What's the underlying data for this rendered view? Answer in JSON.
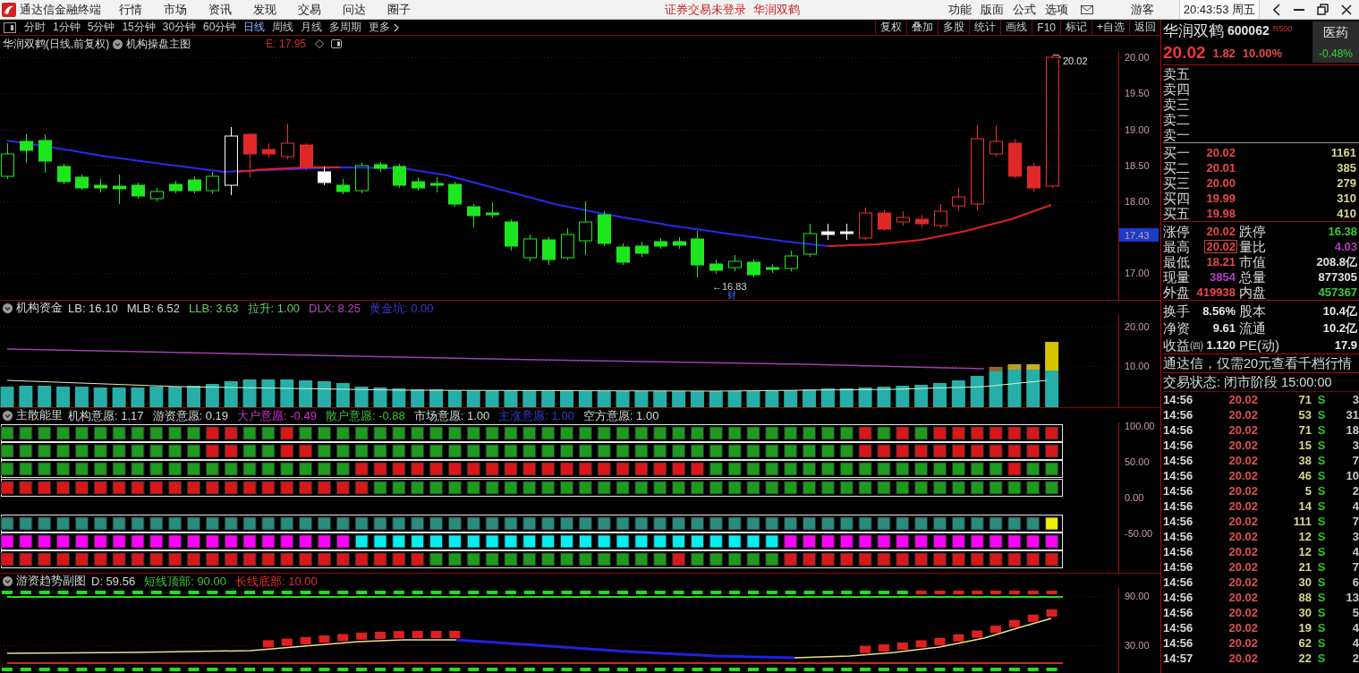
{
  "title_bar": {
    "app_name": "通达信金融终端",
    "menu": [
      "行情",
      "市场",
      "资讯",
      "发现",
      "交易",
      "问达",
      "圈子"
    ],
    "notice": "证券交易未登录",
    "stock_link": "华润双鹤",
    "tools": [
      "功能",
      "版面",
      "公式",
      "选项"
    ],
    "user": "游客",
    "clock": "20:43:53 周五"
  },
  "period_bar": {
    "periods": [
      {
        "label": "分时",
        "selected": false
      },
      {
        "label": "1分钟",
        "selected": false
      },
      {
        "label": "5分钟",
        "selected": false
      },
      {
        "label": "15分钟",
        "selected": false
      },
      {
        "label": "30分钟",
        "selected": false
      },
      {
        "label": "60分钟",
        "selected": false
      },
      {
        "label": "日线",
        "selected": true
      },
      {
        "label": "周线",
        "selected": false
      },
      {
        "label": "月线",
        "selected": false
      },
      {
        "label": "多周期",
        "selected": false
      }
    ],
    "more": "更多",
    "tools": [
      "复权",
      "叠加",
      "多股",
      "统计",
      "画线",
      "F10",
      "标记",
      "+自选",
      "返回"
    ]
  },
  "main_chart": {
    "title": "华润双鹤(日线,前复权)",
    "indicator": "机构操盘主图",
    "readouts": [
      {
        "text": "E: 17.95",
        "color": "#c83232"
      }
    ],
    "price_axis": [
      "20.00",
      "19.50",
      "19.00",
      "18.50",
      "18.00",
      "17.00"
    ],
    "last_price": "17.43",
    "high_label": "20.02",
    "low_label": "←16.83",
    "event_mark": "财"
  },
  "indicator_panels": [
    {
      "kind": "fund_bars",
      "title": "机构资金",
      "readouts": [
        {
          "text": "LB: 16.10",
          "color": "#d8d8d8"
        },
        {
          "text": "MLB: 6.52",
          "color": "#d8d8d8"
        },
        {
          "text": "LLB: 3.63",
          "color": "#6cc86c"
        },
        {
          "text": "拉升: 1.00",
          "color": "#6cc86c"
        },
        {
          "text": "DLX: 8.25",
          "color": "#b048c0"
        },
        {
          "text": "黄金坑: 0.00",
          "color": "#3a3ad0"
        }
      ],
      "axis": [
        "20.00",
        "10.00"
      ]
    },
    {
      "kind": "signal_grid",
      "title": "主散能里",
      "readouts": [
        {
          "text": "机构意愿: 1.17",
          "color": "#d8d8d8"
        },
        {
          "text": "游资意愿: 0.19",
          "color": "#d8d8d8"
        },
        {
          "text": "大户意愿: -0.49",
          "color": "#d030d0"
        },
        {
          "text": "散户意愿: -0.88",
          "color": "#40c040"
        },
        {
          "text": "市场意愿: 1.00",
          "color": "#d8d8d8"
        },
        {
          "text": "主涨意愿: 1.00",
          "color": "#3a3ad0"
        },
        {
          "text": "空方意愿: 1.00",
          "color": "#d8d8d8"
        }
      ],
      "axis": [
        "100.00",
        "50.00",
        "0.00",
        "-50.00"
      ]
    },
    {
      "kind": "trend",
      "title": "游资趋势副图",
      "readouts": [
        {
          "text": "D: 59.56",
          "color": "#d8d8d8"
        },
        {
          "text": "短线顶部: 90.00",
          "color": "#40c040"
        },
        {
          "text": "长线底部: 10.00",
          "color": "#e03030"
        }
      ],
      "axis": [
        "90.00",
        "30.00"
      ]
    }
  ],
  "quote_panel": {
    "name": "华润双鹤",
    "code": "600062",
    "badge": "R500",
    "sector": {
      "name": "医药",
      "change": "-0.48%"
    },
    "price": "20.02",
    "change": "1.82",
    "change_pct": "10.00%",
    "asks": [
      "卖五",
      "卖四",
      "卖三",
      "卖二",
      "卖一"
    ],
    "bids": [
      {
        "label": "买一",
        "price": "20.02",
        "volume": "1161"
      },
      {
        "label": "买二",
        "price": "20.01",
        "volume": "385"
      },
      {
        "label": "买三",
        "price": "20.00",
        "volume": "279"
      },
      {
        "label": "买四",
        "price": "19.99",
        "volume": "310"
      },
      {
        "label": "买五",
        "price": "19.98",
        "volume": "410"
      }
    ],
    "stats": [
      {
        "label": "涨停",
        "value": "20.02",
        "color": "#e84848",
        "outlined": false
      },
      {
        "label": "跌停",
        "value": "16.38",
        "color": "#3cc83c",
        "outlined": false
      },
      {
        "label": "最高",
        "value": "20.02",
        "color": "#e84848",
        "outlined": true
      },
      {
        "label": "量比",
        "value": "4.03",
        "color": "#b040c0",
        "outlined": false
      },
      {
        "label": "最低",
        "value": "18.21",
        "color": "#e84848",
        "outlined": false
      },
      {
        "label": "市值",
        "value": "208.8亿",
        "color": "#e0e0e0",
        "outlined": false
      },
      {
        "label": "现量",
        "value": "3854",
        "color": "#b040c0",
        "outlined": false
      },
      {
        "label": "总量",
        "value": "877305",
        "color": "#e0e0e0",
        "outlined": false
      },
      {
        "label": "外盘",
        "value": "419938",
        "color": "#e84848",
        "outlined": false
      },
      {
        "label": "内盘",
        "value": "457367",
        "color": "#3cc83c",
        "outlined": false
      }
    ],
    "fundamentals": [
      {
        "label": "换手",
        "value": "8.56%"
      },
      {
        "label": "股本",
        "value": "10.4亿"
      },
      {
        "label": "净资",
        "value": "9.61"
      },
      {
        "label": "流通",
        "value": "10.2亿"
      },
      {
        "label": "收益㈣",
        "value": "1.120"
      },
      {
        "label": "PE(动)",
        "value": "17.9"
      }
    ],
    "promo": "通达信，仅需20元查看千档行情",
    "trade_status": "交易状态: 闭市阶段 15:00:00",
    "ticks": [
      {
        "time": "14:56",
        "price": "20.02",
        "volume": "71",
        "side": "S",
        "count": "3"
      },
      {
        "time": "14:56",
        "price": "20.02",
        "volume": "53",
        "side": "S",
        "count": "31"
      },
      {
        "time": "14:56",
        "price": "20.02",
        "volume": "71",
        "side": "S",
        "count": "18"
      },
      {
        "time": "14:56",
        "price": "20.02",
        "volume": "15",
        "side": "S",
        "count": "3"
      },
      {
        "time": "14:56",
        "price": "20.02",
        "volume": "38",
        "side": "S",
        "count": "7"
      },
      {
        "time": "14:56",
        "price": "20.02",
        "volume": "46",
        "side": "S",
        "count": "10"
      },
      {
        "time": "14:56",
        "price": "20.02",
        "volume": "5",
        "side": "S",
        "count": "2"
      },
      {
        "time": "14:56",
        "price": "20.02",
        "volume": "14",
        "side": "S",
        "count": "4"
      },
      {
        "time": "14:56",
        "price": "20.02",
        "volume": "111",
        "side": "S",
        "count": "7"
      },
      {
        "time": "14:56",
        "price": "20.02",
        "volume": "12",
        "side": "S",
        "count": "3"
      },
      {
        "time": "14:56",
        "price": "20.02",
        "volume": "12",
        "side": "S",
        "count": "4"
      },
      {
        "time": "14:56",
        "price": "20.02",
        "volume": "21",
        "side": "S",
        "count": "7"
      },
      {
        "time": "14:56",
        "price": "20.02",
        "volume": "30",
        "side": "S",
        "count": "6"
      },
      {
        "time": "14:56",
        "price": "20.02",
        "volume": "88",
        "side": "S",
        "count": "13"
      },
      {
        "time": "14:56",
        "price": "20.02",
        "volume": "30",
        "side": "S",
        "count": "5"
      },
      {
        "time": "14:56",
        "price": "20.02",
        "volume": "19",
        "side": "S",
        "count": "4"
      },
      {
        "time": "14:56",
        "price": "20.02",
        "volume": "62",
        "side": "S",
        "count": "4"
      },
      {
        "time": "14:57",
        "price": "20.02",
        "volume": "22",
        "side": "S",
        "count": "2"
      }
    ]
  }
}
